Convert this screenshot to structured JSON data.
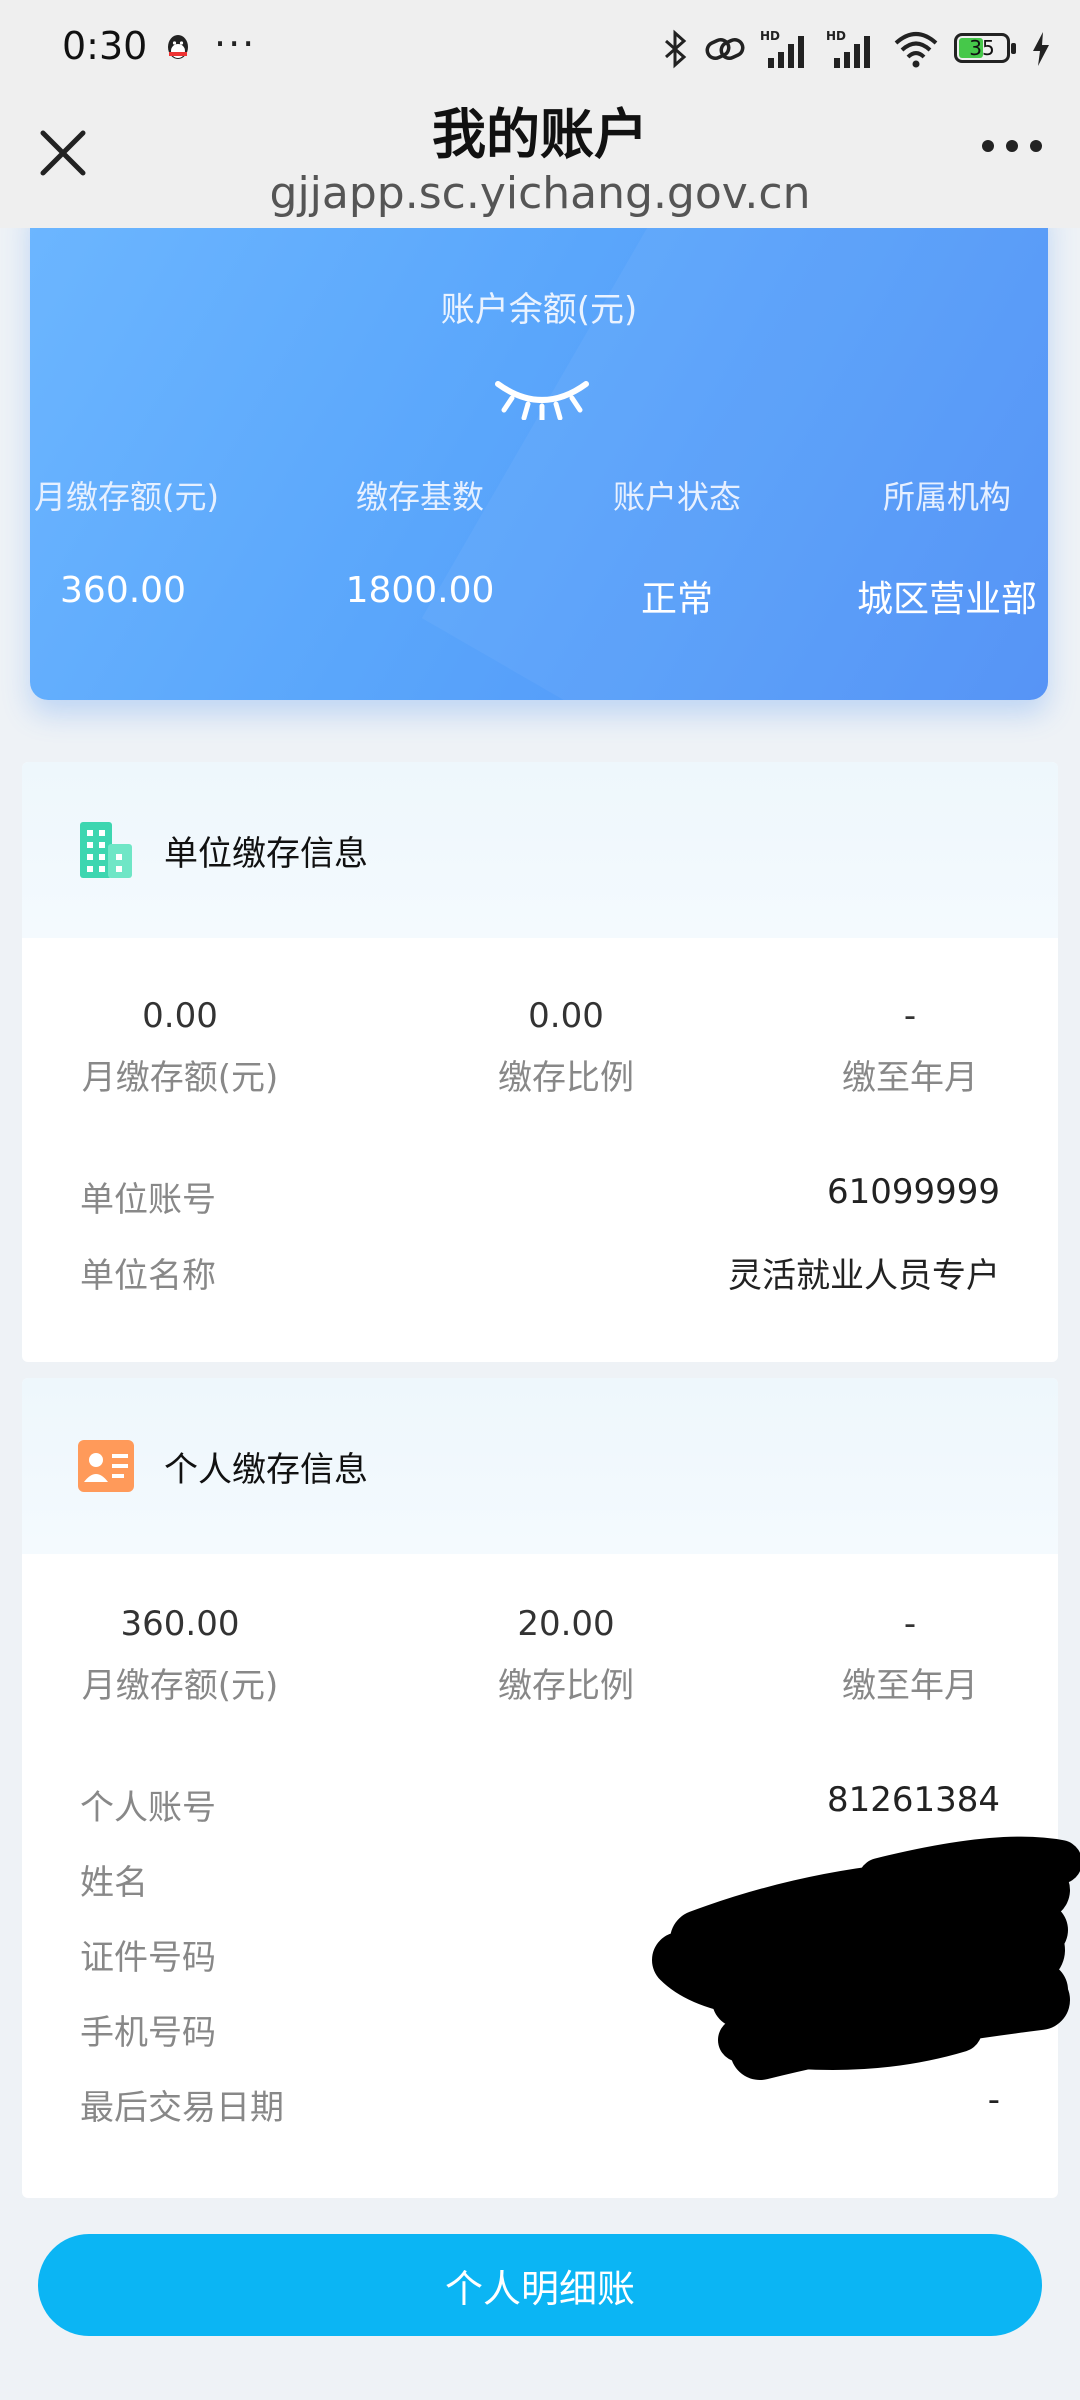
{
  "status_bar": {
    "time": "0:30",
    "dots": "···",
    "battery": "35"
  },
  "header": {
    "title": "我的账户",
    "url": "gjjapp.sc.yichang.gov.cn"
  },
  "balance_card": {
    "label": "账户余额(元)",
    "stats": [
      {
        "label": "月缴存额(元)",
        "value": "360.00"
      },
      {
        "label": "缴存基数",
        "value": "1800.00"
      },
      {
        "label": "账户状态",
        "value": "正常"
      },
      {
        "label": "所属机构",
        "value": "城区营业部"
      }
    ]
  },
  "unit_section": {
    "title": "单位缴存信息",
    "summary": [
      {
        "value": "0.00",
        "label": "月缴存额(元)"
      },
      {
        "value": "0.00",
        "label": "缴存比例"
      },
      {
        "value": "-",
        "label": "缴至年月"
      }
    ],
    "rows": [
      {
        "key": "单位账号",
        "value": "61099999"
      },
      {
        "key": "单位名称",
        "value": "灵活就业人员专户"
      }
    ]
  },
  "personal_section": {
    "title": "个人缴存信息",
    "summary": [
      {
        "value": "360.00",
        "label": "月缴存额(元)"
      },
      {
        "value": "20.00",
        "label": "缴存比例"
      },
      {
        "value": "-",
        "label": "缴至年月"
      }
    ],
    "rows": [
      {
        "key": "个人账号",
        "value": "81261384"
      },
      {
        "key": "姓名",
        "value": ""
      },
      {
        "key": "证件号码",
        "value": ""
      },
      {
        "key": "手机号码",
        "value": ""
      },
      {
        "key": "最后交易日期",
        "value": "-"
      }
    ]
  },
  "detail_button": "个人明细账",
  "colors": {
    "accent": "#0bb5f4",
    "card_blue": "#5aa6fb",
    "building_icon": "#3dd6b0",
    "person_icon": "#ff9a5a"
  }
}
